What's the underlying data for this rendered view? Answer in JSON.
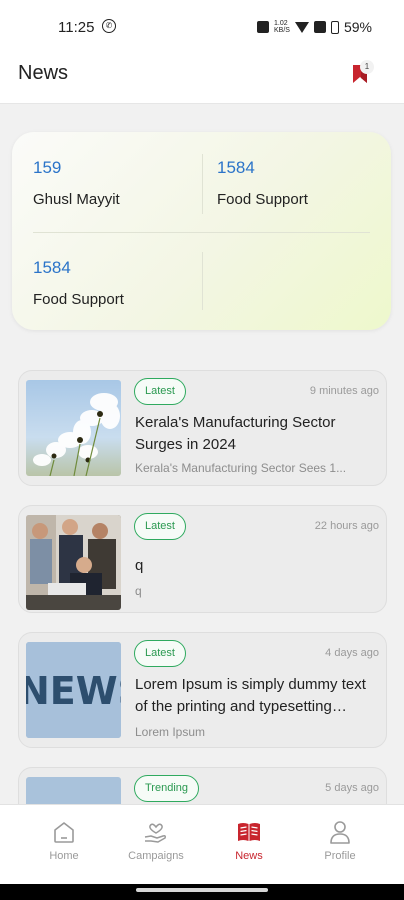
{
  "status_bar": {
    "time": "11:25",
    "battery": "59%",
    "network_top": "1.02",
    "network_bottom": "KB/S"
  },
  "header": {
    "title": "News",
    "bookmark_badge": "1"
  },
  "stats": [
    {
      "value": "159",
      "label": "Ghusl Mayyit"
    },
    {
      "value": "1584",
      "label": "Food Support"
    },
    {
      "value": "1584",
      "label": "Food Support"
    }
  ],
  "news": [
    {
      "tag": "Latest",
      "time": "9 minutes ago",
      "title": "Kerala's Manufacturing Sector Surges in 2024",
      "subtitle": "Kerala's Manufacturing Sector Sees 1..."
    },
    {
      "tag": "Latest",
      "time": "22 hours ago",
      "title": "q",
      "subtitle": "q"
    },
    {
      "tag": "Latest",
      "time": "4 days ago",
      "title": "Lorem Ipsum is simply dummy text of the printing and typesetting industry.",
      "subtitle": "Lorem Ipsum",
      "thumb_text": "NEWS"
    },
    {
      "tag": "Trending",
      "time": "5 days ago"
    }
  ],
  "nav": [
    {
      "label": "Home",
      "icon": "home-icon"
    },
    {
      "label": "Campaigns",
      "icon": "campaigns-icon"
    },
    {
      "label": "News",
      "icon": "news-icon"
    },
    {
      "label": "Profile",
      "icon": "profile-icon"
    }
  ],
  "colors": {
    "accent": "#c8252e",
    "stat_value": "#2b74c9",
    "tag_green": "#2faa5f"
  }
}
